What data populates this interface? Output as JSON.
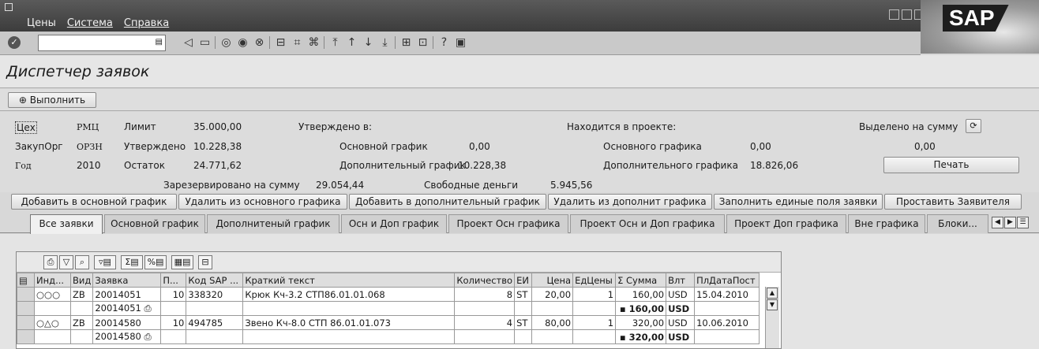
{
  "menu": [
    "Цены",
    "Система",
    "Справка"
  ],
  "logo": "SAP",
  "toolbar": {
    "command_value": ""
  },
  "title": "Диспетчер заявок",
  "app": {
    "execute_label": "Выполнить"
  },
  "header": {
    "ceh_label": "Цех",
    "ceh_value": "РМЦ",
    "zak_label": "ЗакупОрг",
    "zak_value": "ОРЗН",
    "god_label": "Год",
    "god_value": "2010",
    "limit_label": "Лимит",
    "limit_value": "35.000,00",
    "utv_label": "Утверждено",
    "utv_value": "10.228,38",
    "ost_label": "Остаток",
    "ost_value": "24.771,62",
    "utv_v_label": "Утверждено в:",
    "osn_label": "Основной график",
    "osn_value": "0,00",
    "dop_label": "Дополнительный график",
    "dop_value": "10.228,38",
    "proj_label": "Находится в проекте:",
    "posn_label": "Основного графика",
    "posn_value": "0,00",
    "pdop_label": "Дополнительного графика",
    "pdop_value": "18.826,06",
    "vyd_label": "Выделено на сумму",
    "vyd_value": "0,00",
    "print_label": "Печать",
    "rez_label": "Зарезервировано на сумму",
    "rez_value": "29.054,44",
    "svob_label": "Свободные деньги",
    "svob_value": "5.945,56"
  },
  "actions": [
    "Добавить в основной график",
    "Удалить из основного графика",
    "Добавить в дополнительный график",
    "Удалить из дополнит графика",
    "Заполнить единые поля заявки",
    "Проставить Заявителя"
  ],
  "tabs": [
    "Все заявки",
    "Основной график",
    "Дополнитеный график",
    "Осн и Доп график",
    "Проект Осн графика",
    "Проект Осн и Доп графика",
    "Проект Доп графика",
    "Вне графика",
    "Блоки..."
  ],
  "columns": [
    "Инд...",
    "Вид",
    "Заявка",
    "П...",
    "Код SAP ...",
    "Краткий текст",
    "Количество",
    "ЕИ",
    "Цена",
    "ЕдЦены",
    "Σ Сумма",
    "Влт",
    "ПлДатаПост"
  ],
  "rows": [
    {
      "vid": "ZB",
      "zayavka": "20014051",
      "p": "10",
      "kod": "338320",
      "text": "Крюк Кч-3.2 СТП86.01.01.068",
      "kol": "8",
      "ei": "ST",
      "cena": "20,00",
      "ed": "1",
      "summa": "160,00",
      "vlt": "USD",
      "data": "15.04.2010"
    },
    {
      "zayavka": "20014051",
      "summa": "160,00",
      "vlt": "USD"
    },
    {
      "vid": "ZB",
      "zayavka": "20014580",
      "p": "10",
      "kod": "494785",
      "text": "Звено Кч-8.0 СТП 86.01.01.073",
      "kol": "4",
      "ei": "ST",
      "cena": "80,00",
      "ed": "1",
      "summa": "320,00",
      "vlt": "USD",
      "data": "10.06.2010"
    },
    {
      "zayavka": "20014580",
      "summa": "320,00",
      "vlt": "USD"
    }
  ]
}
